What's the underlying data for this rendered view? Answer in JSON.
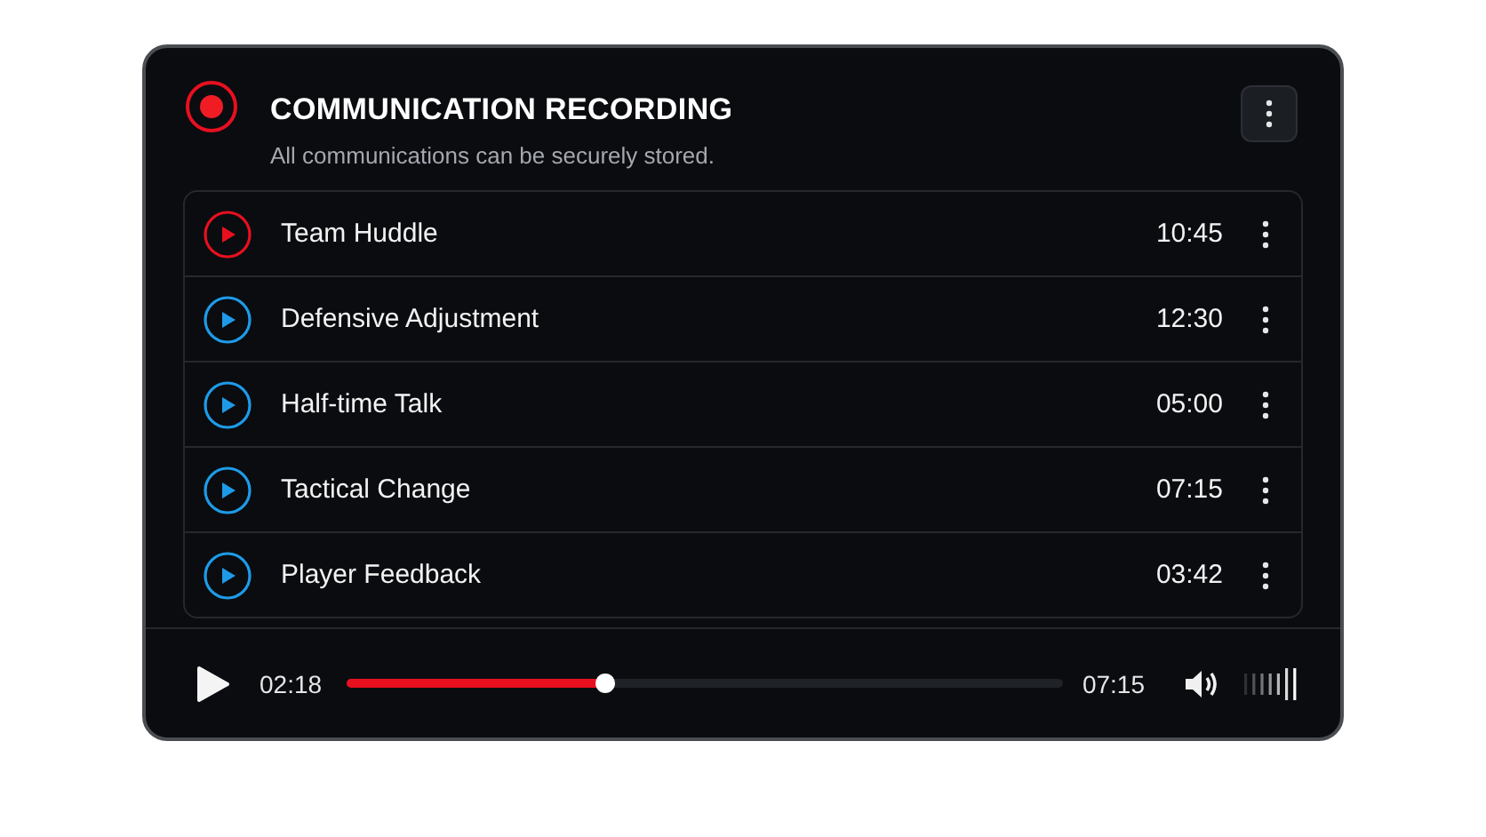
{
  "header": {
    "title": "COMMUNICATION RECORDING",
    "subtitle": "All communications can be securely stored."
  },
  "recordings": [
    {
      "name": "Team Huddle",
      "duration": "10:45",
      "selected": true
    },
    {
      "name": "Defensive Adjustment",
      "duration": "12:30",
      "selected": false
    },
    {
      "name": "Half-time Talk",
      "duration": "05:00",
      "selected": false
    },
    {
      "name": "Tactical Change",
      "duration": "07:15",
      "selected": false
    },
    {
      "name": "Player Feedback",
      "duration": "03:42",
      "selected": false
    }
  ],
  "player": {
    "elapsed": "02:18",
    "total": "07:15",
    "level": 0.36
  }
}
